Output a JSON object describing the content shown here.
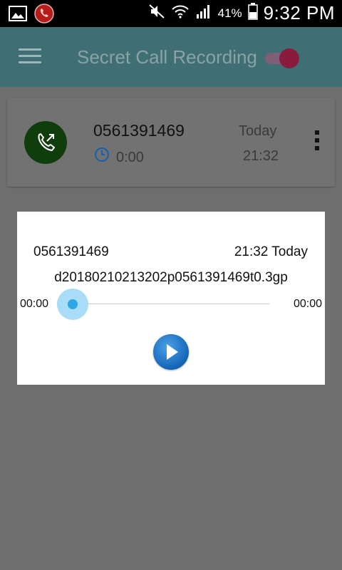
{
  "status_bar": {
    "battery_percent": "41%",
    "time": "9:32 PM",
    "icons": [
      "gallery-icon",
      "call-recorder-icon",
      "mute-icon",
      "wifi-icon",
      "signal-icon",
      "battery-icon"
    ]
  },
  "app_bar": {
    "title": "Secret Call Recording",
    "toggle_on": true,
    "accent_color": "#3f6f74"
  },
  "call_card": {
    "number": "0561391469",
    "duration": "0:00",
    "date": "Today",
    "time": "21:32",
    "icon": "outgoing-call-icon"
  },
  "player_dialog": {
    "number": "0561391469",
    "datetime": "21:32 Today",
    "filename": "d20180210213202p0561391469t0.3gp",
    "elapsed": "00:00",
    "total": "00:00",
    "progress": 0,
    "play_icon": "play-icon"
  }
}
